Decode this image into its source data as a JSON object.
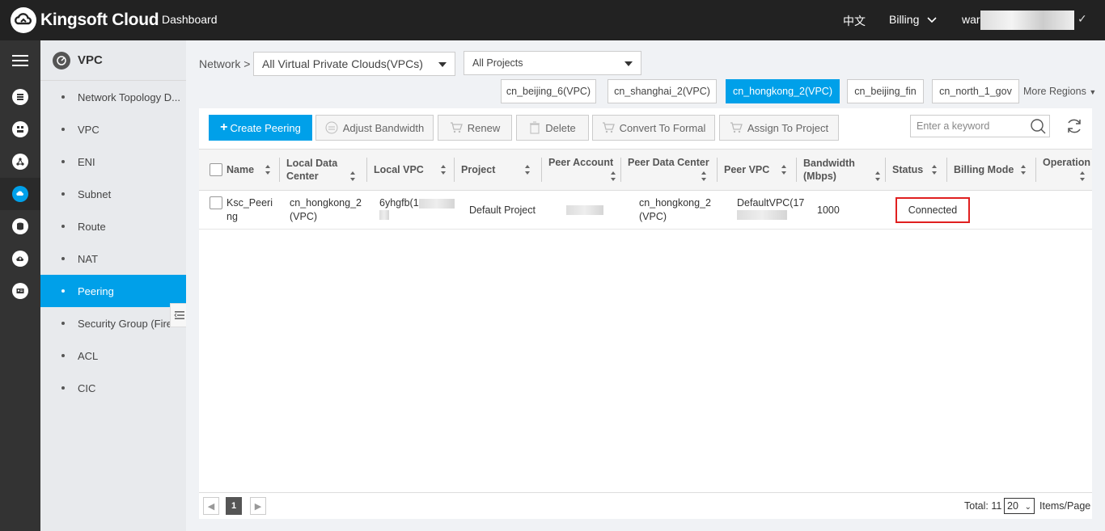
{
  "topbar": {
    "brand": "Kingsoft Cloud",
    "dashboard": "Dashboard",
    "language": "中文",
    "billing": "Billing",
    "user_prefix": "war"
  },
  "rail": {
    "icons": [
      "menu-icon",
      "database-icon",
      "server-icon",
      "network-icon",
      "vpc-icon",
      "storage-icon",
      "cloud-upload-icon",
      "id-card-icon"
    ]
  },
  "subnav": {
    "title": "VPC",
    "items": [
      {
        "label": "Network Topology D..."
      },
      {
        "label": "VPC"
      },
      {
        "label": "ENI"
      },
      {
        "label": "Subnet"
      },
      {
        "label": "Route"
      },
      {
        "label": "NAT"
      },
      {
        "label": "Peering"
      },
      {
        "label": "Security Group (Fire..."
      },
      {
        "label": "ACL"
      },
      {
        "label": "CIC"
      }
    ],
    "active_index": 6
  },
  "filters": {
    "breadcrumb": "Network >",
    "vpc_select": "All Virtual Private Clouds(VPCs)",
    "project_select": "All Projects"
  },
  "regions": {
    "tabs": [
      {
        "label": "cn_beijing_6(VPC)"
      },
      {
        "label": "cn_shanghai_2(VPC)"
      },
      {
        "label": "cn_hongkong_2(VPC)"
      },
      {
        "label": "cn_beijing_fin"
      },
      {
        "label": "cn_north_1_gov"
      }
    ],
    "active_index": 2,
    "more": "More Regions"
  },
  "toolbar": {
    "create": "Create Peering",
    "adjust": "Adjust Bandwidth",
    "renew": "Renew",
    "delete": "Delete",
    "convert": "Convert To Formal",
    "assign": "Assign To Project",
    "search_placeholder": "Enter a keyword"
  },
  "table": {
    "columns": {
      "name": "Name",
      "local_dc": "Local Data Center",
      "local_vpc": "Local VPC",
      "project": "Project",
      "peer_account": "Peer Account",
      "peer_dc": "Peer Data Center",
      "peer_vpc": "Peer VPC",
      "bandwidth": "Bandwidth (Mbps)",
      "status": "Status",
      "billing": "Billing Mode",
      "operation": "Operation"
    },
    "rows": [
      {
        "name": "Ksc_Peering",
        "local_dc": "cn_hongkong_2 (VPC)",
        "local_vpc": "6yhgfb(1",
        "project": "Default Project",
        "peer_dc": "cn_hongkong_2(VPC)",
        "peer_vpc": "DefaultVPC(17",
        "bandwidth": "1000",
        "status": "Connected"
      }
    ]
  },
  "pager": {
    "page": "1",
    "total_label": "Total: 11",
    "per_page": "20",
    "items_label": "Items/Page"
  },
  "colors": {
    "accent": "#00a0e9",
    "topbar": "#222222",
    "highlight": "#e02020"
  }
}
